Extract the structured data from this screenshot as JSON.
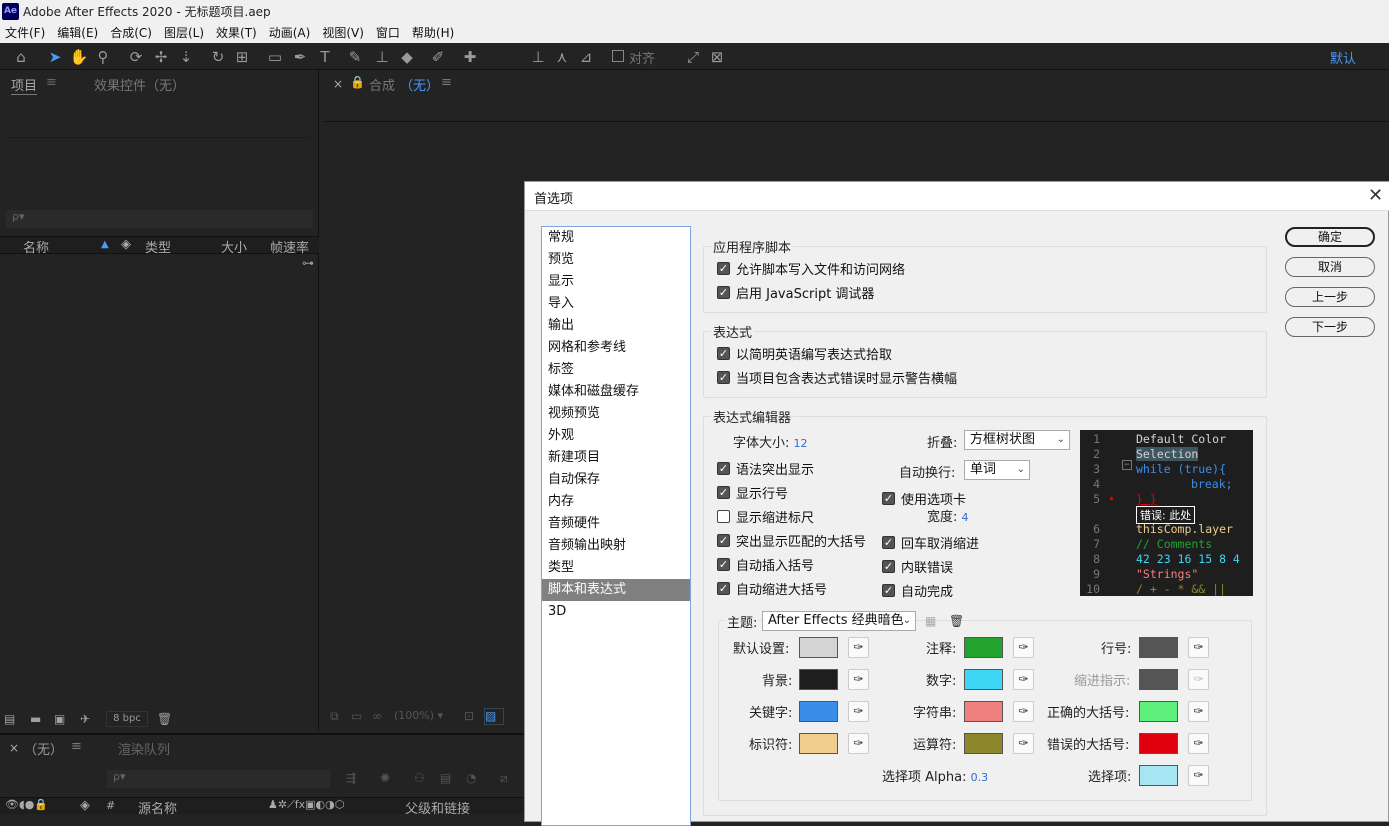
{
  "app": {
    "title": "Adobe After Effects 2020 - 无标题项目.aep",
    "logo": "Ae"
  },
  "menu": [
    "文件(F)",
    "编辑(E)",
    "合成(C)",
    "图层(L)",
    "效果(T)",
    "动画(A)",
    "视图(V)",
    "窗口",
    "帮助(H)"
  ],
  "toolbar": {
    "snap_label": "对齐",
    "workspace": "默认"
  },
  "project": {
    "tab_project": "项目",
    "tab_effects": "效果控件（无）",
    "search_placeholder": "ρ▾",
    "cols": [
      "名称",
      "类型",
      "大小",
      "帧速率"
    ],
    "bpc": "8 bpc"
  },
  "comp": {
    "tab": "合成",
    "tab_value": "（无）",
    "zoom": "(100%)"
  },
  "timeline": {
    "tab": "（无）",
    "render_queue": "渲染队列",
    "col_source": "源名称",
    "col_parent": "父级和链接"
  },
  "dialog": {
    "title": "首选项",
    "categories": [
      "常规",
      "预览",
      "显示",
      "导入",
      "输出",
      "网格和参考线",
      "标签",
      "媒体和磁盘缓存",
      "视频预览",
      "外观",
      "新建项目",
      "自动保存",
      "内存",
      "音频硬件",
      "音频输出映射",
      "类型",
      "脚本和表达式",
      "3D"
    ],
    "selected_index": 16,
    "buttons": {
      "ok": "确定",
      "cancel": "取消",
      "prev": "上一步",
      "next": "下一步"
    },
    "scripting": {
      "title": "应用程序脚本",
      "allow_write": "允许脚本写入文件和访问网络",
      "enable_debugger": "启用 JavaScript 调试器"
    },
    "expressions": {
      "title": "表达式",
      "pickwhip": "以简明英语编写表达式拾取",
      "warn_banner": "当项目包含表达式错误时显示警告横幅"
    },
    "editor": {
      "title": "表达式编辑器",
      "font_size_label": "字体大小:",
      "font_size": "12",
      "fold_label": "折叠:",
      "fold_value": "方框树状图",
      "wrap_label": "自动换行:",
      "wrap_value": "单词",
      "syntax_highlight": "语法突出显示",
      "line_numbers": "显示行号",
      "indent_guides": "显示缩进标尺",
      "match_brackets": "突出显示匹配的大括号",
      "auto_brackets": "自动插入括号",
      "auto_indent": "自动缩进大括号",
      "use_tabs": "使用选项卡",
      "width_label": "宽度:",
      "width_value": "4",
      "enter_unindent": "回车取消缩进",
      "inline_errors": "内联错误",
      "autocomplete": "自动完成",
      "code_lines": [
        "Default Color",
        "Selection",
        "while (true){",
        "break;",
        "} }",
        "错误: 此处",
        "thisComp.layer",
        "// Comments",
        "42 23 16 15 8 4",
        "\"Strings\"",
        "/ + - * && ||"
      ],
      "line_nums": [
        "1",
        "2",
        "3",
        "4",
        "5",
        "6",
        "7",
        "8",
        "9",
        "10"
      ]
    },
    "theme": {
      "label": "主题:",
      "value": "After Effects 经典暗色",
      "default_label": "默认设置:",
      "default_color": "#d4d4d4",
      "bg_label": "背景:",
      "bg_color": "#1e1e1e",
      "keyword_label": "关键字:",
      "keyword_color": "#3b8ee8",
      "identifier_label": "标识符:",
      "identifier_color": "#f0cf8e",
      "comment_label": "注释:",
      "comment_color": "#22a22f",
      "number_label": "数字:",
      "number_color": "#3ed6f5",
      "string_label": "字符串:",
      "string_color": "#f08080",
      "operator_label": "运算符:",
      "operator_color": "#8c872a",
      "lineno_label": "行号:",
      "lineno_color": "#555555",
      "indent_label": "缩进指示:",
      "indent_color": "#555555",
      "good_bracket_label": "正确的大括号:",
      "good_bracket_color": "#5ef07a",
      "bad_bracket_label": "错误的大括号:",
      "bad_bracket_color": "#e0000d",
      "sel_alpha_label": "选择项 Alpha:",
      "sel_alpha": "0.3",
      "selection_label": "选择项:",
      "selection_color": "#a6e6f2"
    }
  }
}
